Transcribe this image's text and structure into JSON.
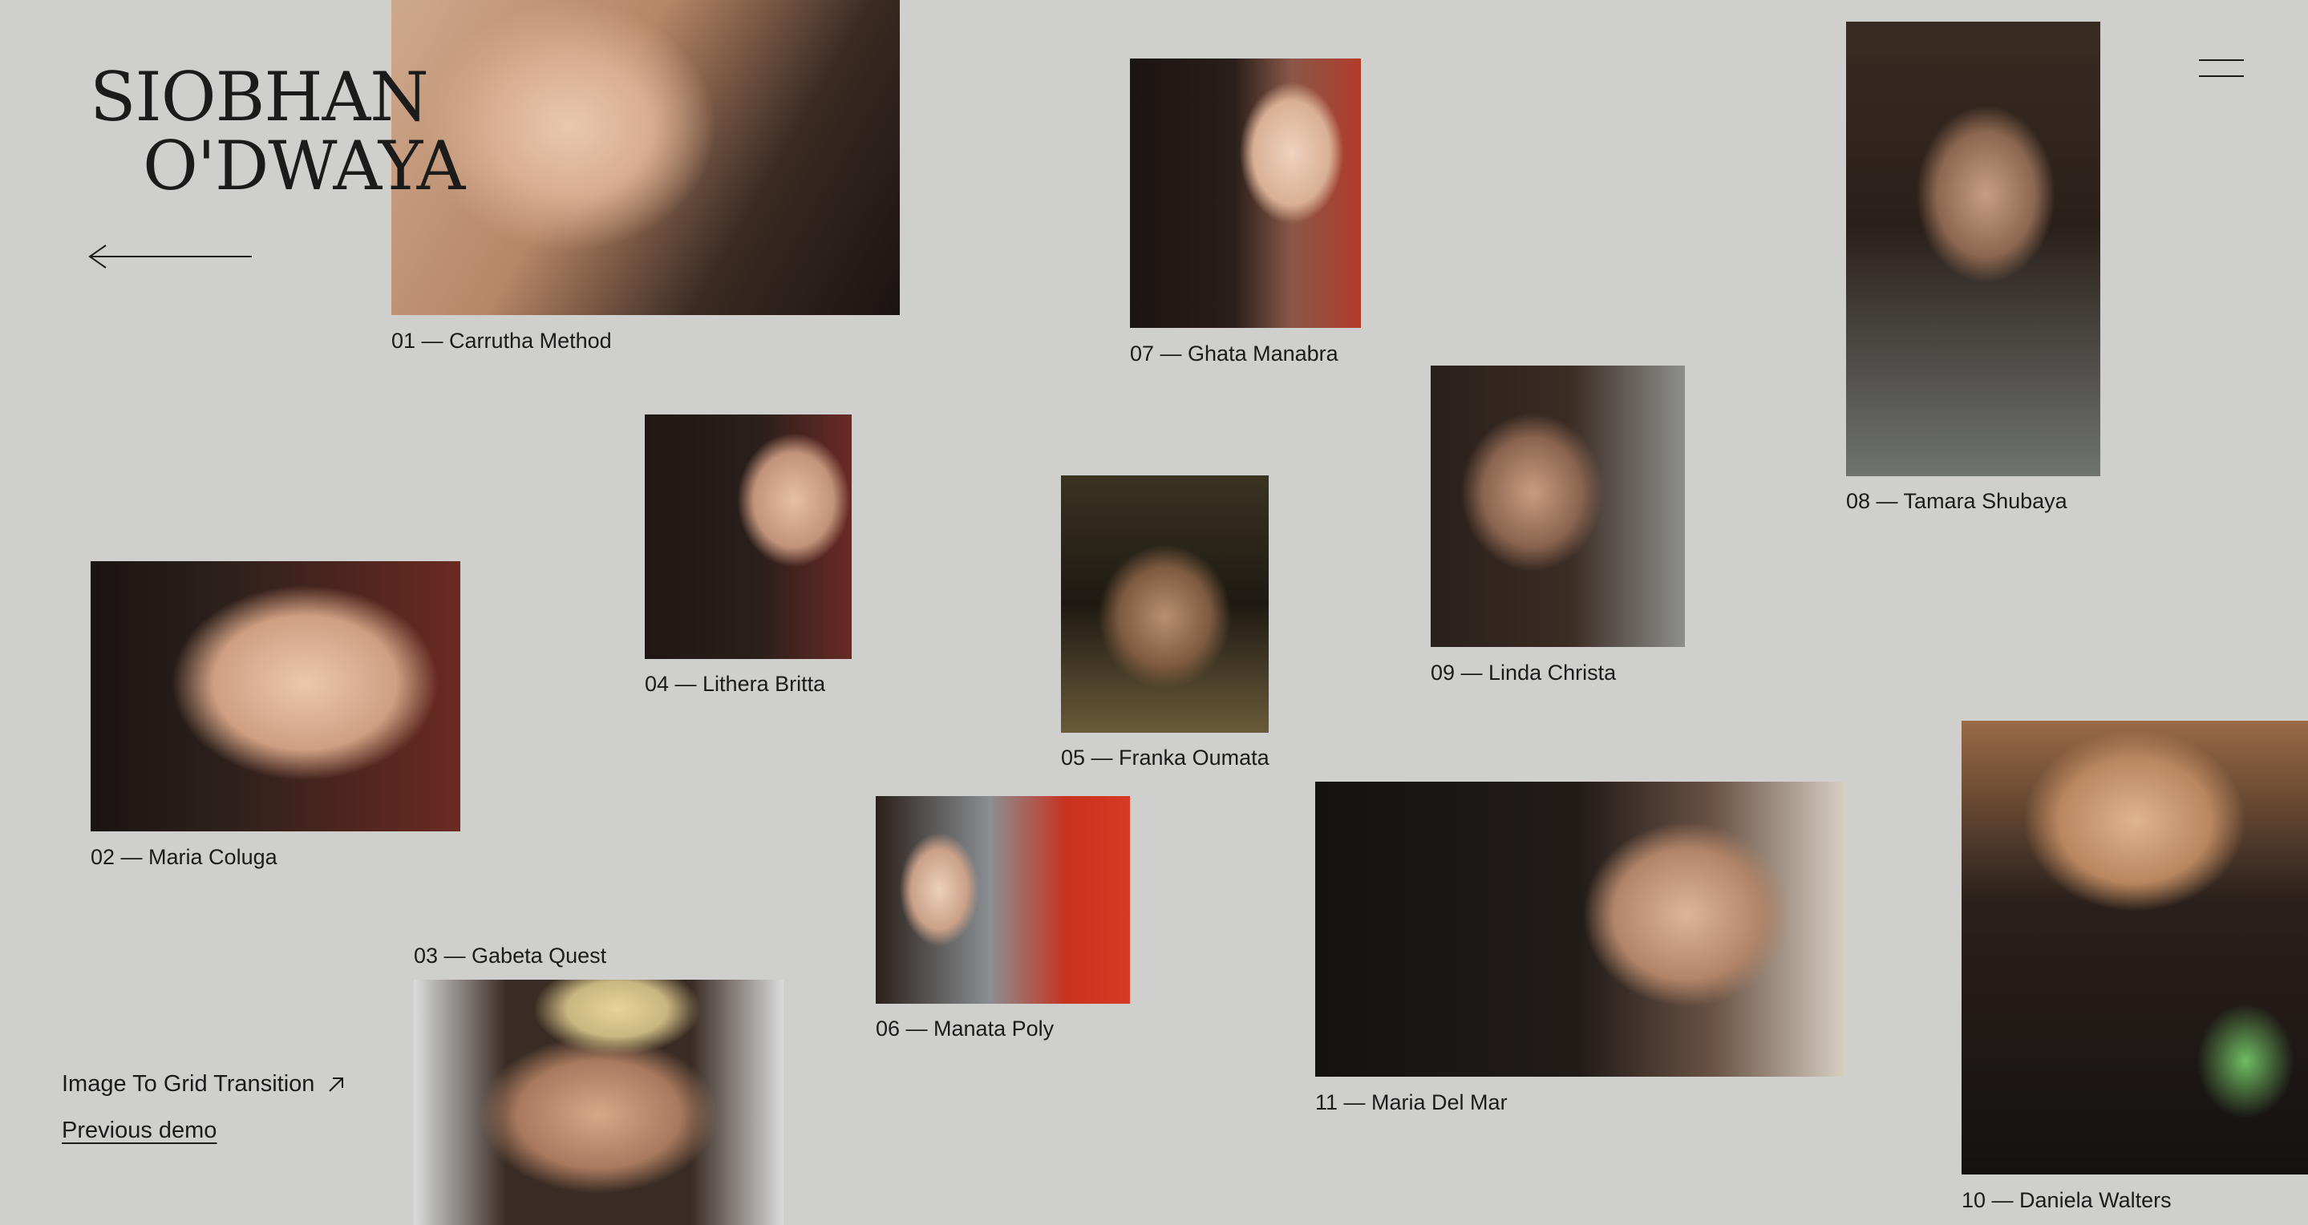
{
  "title": {
    "line1": "SIOBHAN",
    "line2": "O'DWAYA"
  },
  "nav": {
    "back_icon": "arrow-left-icon",
    "menu_icon": "hamburger-menu-icon"
  },
  "gallery": [
    {
      "caption": "01 — Carrutha Method"
    },
    {
      "caption": "02 — Maria Coluga"
    },
    {
      "caption": "03 — Gabeta Quest"
    },
    {
      "caption": "04 — Lithera Britta"
    },
    {
      "caption": "05 — Franka Oumata"
    },
    {
      "caption": "06 — Manata Poly"
    },
    {
      "caption": "07 — Ghata Manabra"
    },
    {
      "caption": "08 — Tamara Shubaya"
    },
    {
      "caption": "09 — Linda Christa"
    },
    {
      "caption": "10 — Daniela Walters"
    },
    {
      "caption": "11 — Maria Del Mar"
    }
  ],
  "footer": {
    "demo_title": "Image To Grid Transition",
    "demo_icon": "arrow-up-right-icon",
    "previous_link": "Previous demo"
  }
}
